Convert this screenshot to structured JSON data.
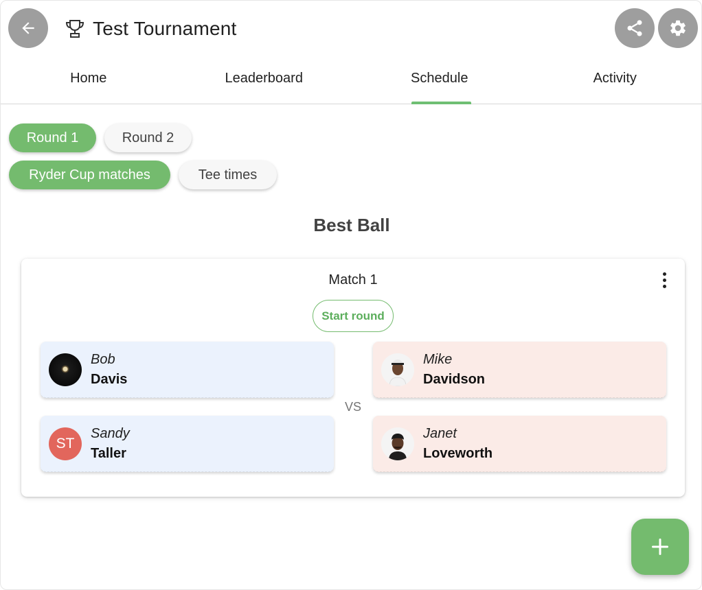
{
  "header": {
    "title": "Test Tournament",
    "back_icon": "arrow-left-icon",
    "trophy_icon": "trophy-icon",
    "share_icon": "share-icon",
    "settings_icon": "gear-icon"
  },
  "tabs": [
    {
      "label": "Home",
      "selected": false
    },
    {
      "label": "Leaderboard",
      "selected": false
    },
    {
      "label": "Schedule",
      "selected": true
    },
    {
      "label": "Activity",
      "selected": false
    }
  ],
  "rounds": [
    {
      "label": "Round 1",
      "selected": true
    },
    {
      "label": "Round 2",
      "selected": false
    }
  ],
  "views": [
    {
      "label": "Ryder Cup matches",
      "selected": true
    },
    {
      "label": "Tee times",
      "selected": false
    }
  ],
  "section": {
    "title": "Best Ball"
  },
  "match": {
    "title": "Match 1",
    "start_label": "Start round",
    "vs_label": "VS",
    "team_a": [
      {
        "first": "Bob",
        "last": "Davis",
        "avatar": "dark-photo"
      },
      {
        "first": "Sandy",
        "last": "Taller",
        "avatar_initials": "ST"
      }
    ],
    "team_b": [
      {
        "first": "Mike",
        "last": "Davidson",
        "avatar": "photo"
      },
      {
        "first": "Janet",
        "last": "Loveworth",
        "avatar": "photo"
      }
    ]
  },
  "fab": {
    "icon": "plus-icon"
  },
  "colors": {
    "accent": "#74bb6e",
    "team_a_bg": "#ebf2fd",
    "team_b_bg": "#fbebe7",
    "initials_avatar": "#e2665c",
    "header_button": "#9e9e9e"
  }
}
